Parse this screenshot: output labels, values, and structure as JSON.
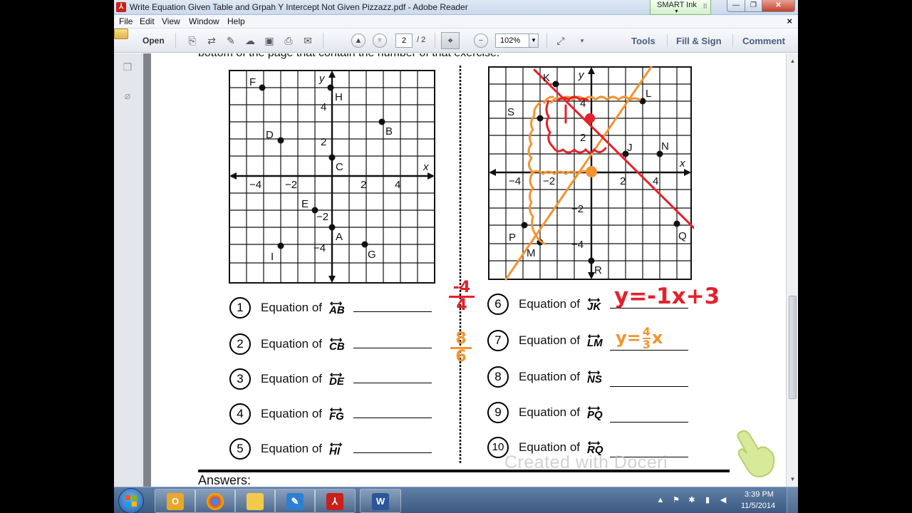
{
  "window": {
    "title": "Write Equation Given Table and Grpah Y Intercept Not Given Pizzazz.pdf - Adobe Reader",
    "app_icon": "pdf-app-icon",
    "smart_ink_label": "SMART Ink",
    "minimize_glyph": "—",
    "maximize_glyph": "❐",
    "close_glyph": "✕"
  },
  "menu": {
    "items": [
      "File",
      "Edit",
      "View",
      "Window",
      "Help"
    ],
    "close_glyph": "×"
  },
  "toolbar": {
    "open_label": "Open",
    "page_current": "2",
    "page_total": "/ 2",
    "zoom": "102%",
    "tools_label": "Tools",
    "fill_sign_label": "Fill & Sign",
    "comment_label": "Comment"
  },
  "document": {
    "instruction": "bottom of the page that contain the number of that exercise.",
    "left_graph": {
      "axis_x": "x",
      "axis_y": "y",
      "tick_labels_x": [
        "−4",
        "−2",
        "2",
        "4"
      ],
      "tick_labels_y": [
        "4",
        "2",
        "−2",
        "−4"
      ],
      "points": [
        "F",
        "H",
        "D",
        "B",
        "C",
        "E",
        "A",
        "I",
        "G"
      ]
    },
    "right_graph": {
      "axis_x": "x",
      "axis_y": "y",
      "tick_labels_x": [
        "−4",
        "−2",
        "2",
        "4"
      ],
      "tick_labels_y": [
        "4",
        "2",
        "−2",
        "−4"
      ],
      "points": [
        "K",
        "L",
        "S",
        "J",
        "N",
        "P",
        "M",
        "Q",
        "R"
      ]
    },
    "equations_left": [
      {
        "num": "1",
        "label": "Equation of",
        "seg": "AB"
      },
      {
        "num": "2",
        "label": "Equation of",
        "seg": "CB"
      },
      {
        "num": "3",
        "label": "Equation of",
        "seg": "DE"
      },
      {
        "num": "4",
        "label": "Equation of",
        "seg": "FG"
      },
      {
        "num": "5",
        "label": "Equation of",
        "seg": "HI"
      }
    ],
    "equations_right": [
      {
        "num": "6",
        "label": "Equation of",
        "seg": "JK"
      },
      {
        "num": "7",
        "label": "Equation of",
        "seg": "LM"
      },
      {
        "num": "8",
        "label": "Equation of",
        "seg": "NS"
      },
      {
        "num": "9",
        "label": "Equation of",
        "seg": "PQ"
      },
      {
        "num": "10",
        "label": "Equation of",
        "seg": "RQ"
      }
    ],
    "handwriting": {
      "answer_6": "y=-1x+3",
      "answer_7_prefix": "y=",
      "answer_7_num": "4",
      "answer_7_den": "3",
      "answer_7_suffix": "x",
      "margin_red_num": "-4",
      "margin_red_den": "4",
      "margin_orange_num": "8",
      "margin_orange_den": "6"
    },
    "answers_label": "Answers:",
    "watermark": "Created with Doceri"
  },
  "taskbar": {
    "apps": [
      "outlook",
      "chrome",
      "file-explorer",
      "smart-notebook",
      "adobe-reader",
      "word"
    ],
    "time": "3:39 PM",
    "date": "11/5/2014"
  },
  "colors": {
    "ink_red": "#e5212b",
    "ink_orange": "#f39331",
    "accent_blue": "#4a6082"
  }
}
